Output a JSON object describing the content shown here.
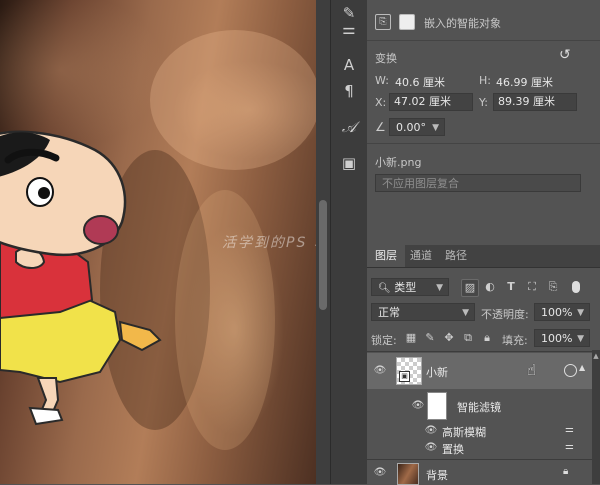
{
  "canvas": {
    "watermark": "活学到的PS 笔记"
  },
  "tools_strip": {
    "items": [
      "brush-tool-icon",
      "adjust-tool-icon",
      "character-tool-icon",
      "paragraph-tool-icon",
      "glyph-tool-icon",
      "layer-comp-icon"
    ]
  },
  "properties": {
    "header_label": "嵌入的智能对象",
    "section_transform": "变换",
    "w_label": "W:",
    "w_value": "40.6 厘米",
    "h_label": "H:",
    "h_value": "46.99 厘米",
    "x_label": "X:",
    "x_value": "47.02 厘米",
    "y_label": "Y:",
    "y_value": "89.39 厘米",
    "angle_value": "0.00°",
    "filename": "小新.png",
    "comp_dropdown": "不应用图层复合"
  },
  "layers_panel": {
    "tabs": [
      "图层",
      "通道",
      "路径"
    ],
    "filter_type": "类型",
    "blend_mode": "正常",
    "opacity_label": "不透明度:",
    "opacity_value": "100%",
    "lock_label": "锁定:",
    "fill_label": "填充:",
    "fill_value": "100%",
    "layers": [
      {
        "name": "小新",
        "selected": true
      },
      {
        "name": "智能滤镜"
      },
      {
        "name": "高斯模糊"
      },
      {
        "name": "置换"
      },
      {
        "name": "背景"
      }
    ]
  },
  "colors": {
    "panel": "#535353",
    "dark": "#3c3c3c",
    "selected_row": "#696969",
    "shin_shirt": "#d9323b",
    "shin_pants": "#f1e24a"
  }
}
